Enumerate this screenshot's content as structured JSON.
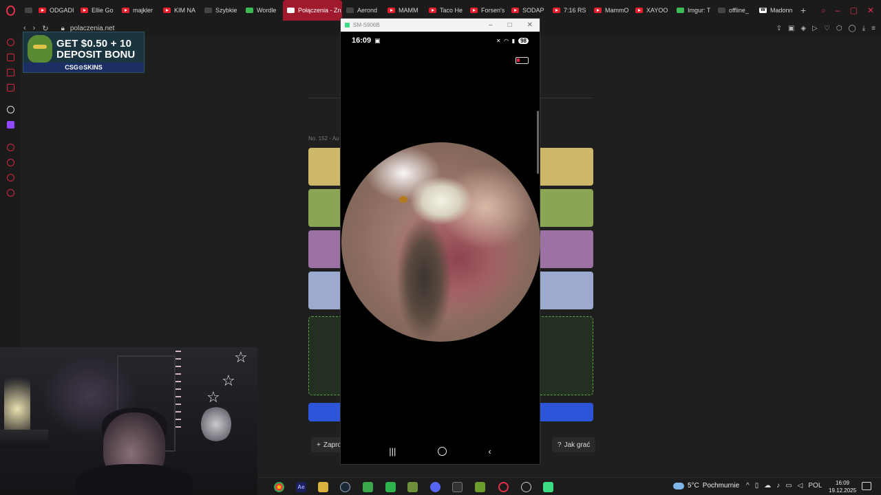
{
  "browser": {
    "tabs": [
      {
        "label": "ODGADI",
        "icon": "youtube-icon"
      },
      {
        "label": "Ellie Go",
        "icon": "youtube-icon"
      },
      {
        "label": "majkler",
        "icon": "youtube-icon"
      },
      {
        "label": "KIM NA",
        "icon": "youtube-icon"
      },
      {
        "label": "Szybkie",
        "icon": "grid-icon"
      },
      {
        "label": "Wordle",
        "icon": "wordle-icon"
      },
      {
        "label": "Połączenia - Zn",
        "icon": "connections-icon",
        "active": true
      },
      {
        "label": "Aerond",
        "icon": "sword-icon"
      },
      {
        "label": "MAMM",
        "icon": "youtube-icon"
      },
      {
        "label": "Taco He",
        "icon": "youtube-icon"
      },
      {
        "label": "Forsen's",
        "icon": "youtube-icon"
      },
      {
        "label": "SODAP",
        "icon": "youtube-icon"
      },
      {
        "label": "7:16 RS",
        "icon": "youtube-icon"
      },
      {
        "label": "MammO",
        "icon": "youtube-icon"
      },
      {
        "label": "XAYOO",
        "icon": "youtube-icon"
      },
      {
        "label": "Imgur: T",
        "icon": "imgur-icon"
      },
      {
        "label": "offline_",
        "icon": "file-icon"
      },
      {
        "label": "Madonn",
        "icon": "wikipedia-icon"
      }
    ],
    "url": "polaczenia.net",
    "accent": "#e8304a"
  },
  "ad": {
    "line1": "GET $0.50 + 10",
    "line2": "DEPOSIT BONU",
    "brand": "CSG⊙SKINS"
  },
  "game": {
    "puzzle_label": "No. 152 - Au",
    "group_colors": [
      "#cdb768",
      "#8aa553",
      "#9b72a3",
      "#9daad0"
    ],
    "share_label": "Zapro",
    "help_label": "Jak grać"
  },
  "phone": {
    "window_title": "SM-S906B",
    "time": "16:09",
    "battery": "98"
  },
  "taskbar": {
    "weather_temp": "5°C",
    "weather_desc": "Pochmurnie",
    "lang": "POL",
    "time": "16:09",
    "date": "19.12.2025"
  }
}
